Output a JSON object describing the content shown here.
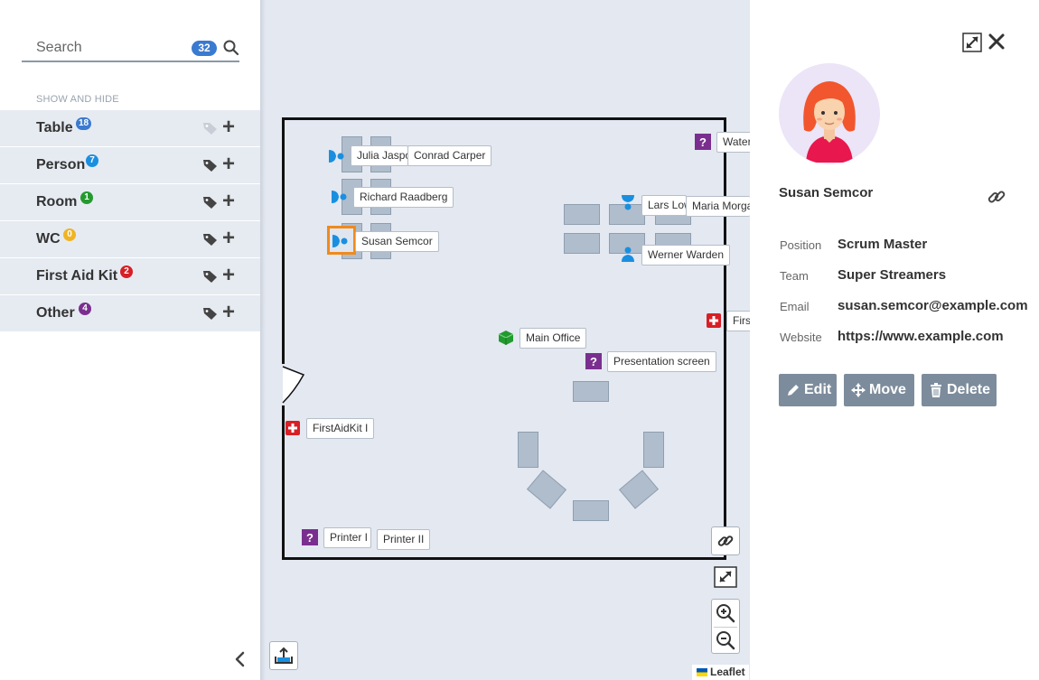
{
  "sidebar": {
    "search": {
      "placeholder": "Search",
      "count": "32"
    },
    "section_heading": "SHOW AND HIDE",
    "categories": [
      {
        "label": "Table",
        "count": "18",
        "badge_color": "#3a7ad0"
      },
      {
        "label": "Person",
        "count": "7",
        "badge_color": "#1a8fe0"
      },
      {
        "label": "Room",
        "count": "1",
        "badge_color": "#239a2e"
      },
      {
        "label": "WC",
        "count": "0",
        "badge_color": "#f0b423"
      },
      {
        "label": "First Aid Kit",
        "count": "2",
        "badge_color": "#d81f26"
      },
      {
        "label": "Other",
        "count": "4",
        "badge_color": "#7a2f8f"
      }
    ]
  },
  "map": {
    "labels": {
      "julia": "Julia Jaspo",
      "conrad": "Conrad Carper",
      "richard": "Richard Raadberg",
      "susan": "Susan Semcor",
      "lars": "Lars Low",
      "maria": "Maria Morga",
      "werner": "Werner Warden",
      "water": "Water",
      "first_right": "First",
      "main_office": "Main Office",
      "presentation": "Presentation screen",
      "first_aid_left": "FirstAidKit I",
      "printer1": "Printer I",
      "printer2": "Printer II"
    },
    "attribution": "Leaflet"
  },
  "detail": {
    "name": "Susan Semcor",
    "fields": [
      {
        "key": "Position",
        "value": "Scrum Master"
      },
      {
        "key": "Team",
        "value": "Super Streamers"
      },
      {
        "key": "Email",
        "value": "susan.semcor@example.com"
      },
      {
        "key": "Website",
        "value": "https://www.example.com"
      }
    ],
    "actions": {
      "edit": "Edit",
      "move": "Move",
      "delete": "Delete"
    }
  },
  "colors": {
    "person": "#1a8fe0",
    "other": "#7a2f8f",
    "first_aid": "#d81f26",
    "room": "#239a2e",
    "selection": "#f08a1c",
    "button_gray": "#7d8c9c"
  }
}
